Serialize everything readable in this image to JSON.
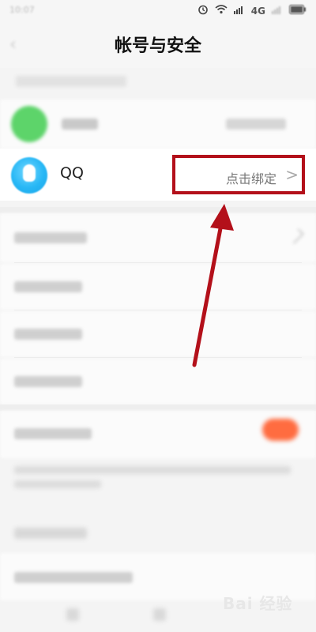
{
  "statusbar": {
    "time": "10:07",
    "network": "4G"
  },
  "header": {
    "title": "帐号与安全",
    "back_icon": "back-arrow-icon"
  },
  "bind": {
    "qq_label": "QQ",
    "qq_bind_text": "点击绑定",
    "bind_chevron": ">"
  },
  "watermark": {
    "text": "Bai 经验"
  },
  "colors": {
    "highlight_box": "#b3101a",
    "annotation_arrow": "#b3101a",
    "toggle_on": "#ff6c40"
  }
}
